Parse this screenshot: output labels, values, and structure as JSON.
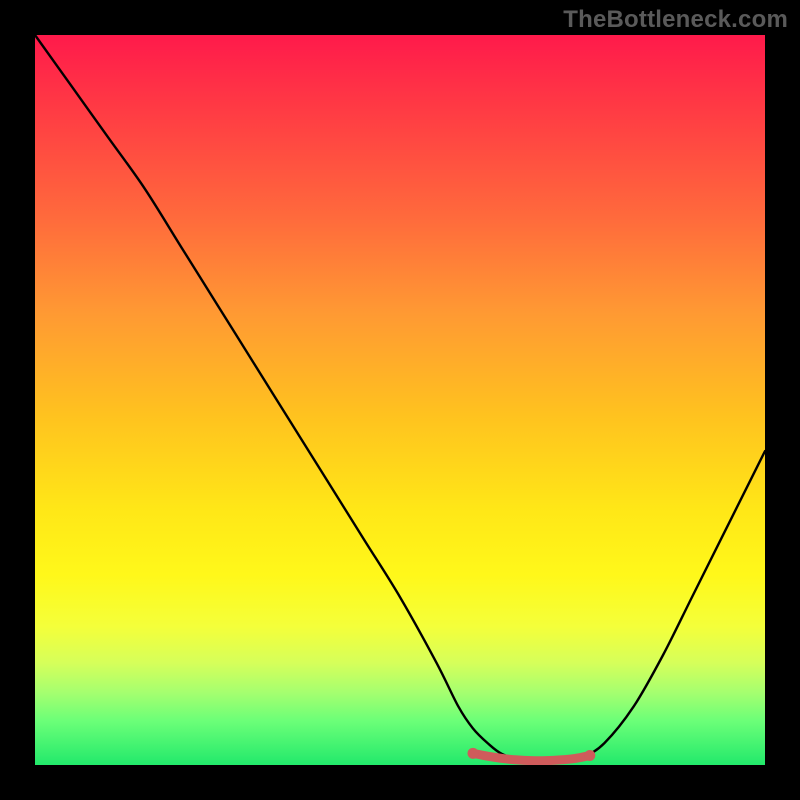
{
  "watermark": "TheBottleneck.com",
  "chart_data": {
    "type": "line",
    "title": "",
    "xlabel": "",
    "ylabel": "",
    "xlim": [
      0,
      100
    ],
    "ylim": [
      0,
      100
    ],
    "series": [
      {
        "name": "bottleneck-curve",
        "x": [
          0,
          5,
          10,
          15,
          20,
          25,
          30,
          35,
          40,
          45,
          50,
          55,
          58,
          60,
          62,
          64,
          67,
          70,
          73,
          75,
          78,
          82,
          86,
          90,
          94,
          98,
          100
        ],
        "values": [
          100,
          93,
          86,
          79,
          71,
          63,
          55,
          47,
          39,
          31,
          23,
          14,
          8,
          5,
          3,
          1.5,
          0.6,
          0.4,
          0.6,
          1.0,
          3,
          8,
          15,
          23,
          31,
          39,
          43
        ],
        "color": "#000000",
        "width": 2.4
      },
      {
        "name": "optimal-band",
        "x": [
          60,
          62,
          64,
          66,
          68,
          70,
          72,
          74,
          76
        ],
        "values": [
          1.6,
          1.2,
          0.9,
          0.7,
          0.6,
          0.6,
          0.7,
          0.9,
          1.3
        ],
        "color": "#cf5b5b",
        "width": 9
      }
    ],
    "markers": [
      {
        "name": "optimal-start-dot",
        "x": 60,
        "y": 1.6,
        "r": 5.5,
        "color": "#cf5b5b"
      },
      {
        "name": "optimal-end-dot",
        "x": 76,
        "y": 1.3,
        "r": 5.5,
        "color": "#cf5b5b"
      }
    ]
  }
}
